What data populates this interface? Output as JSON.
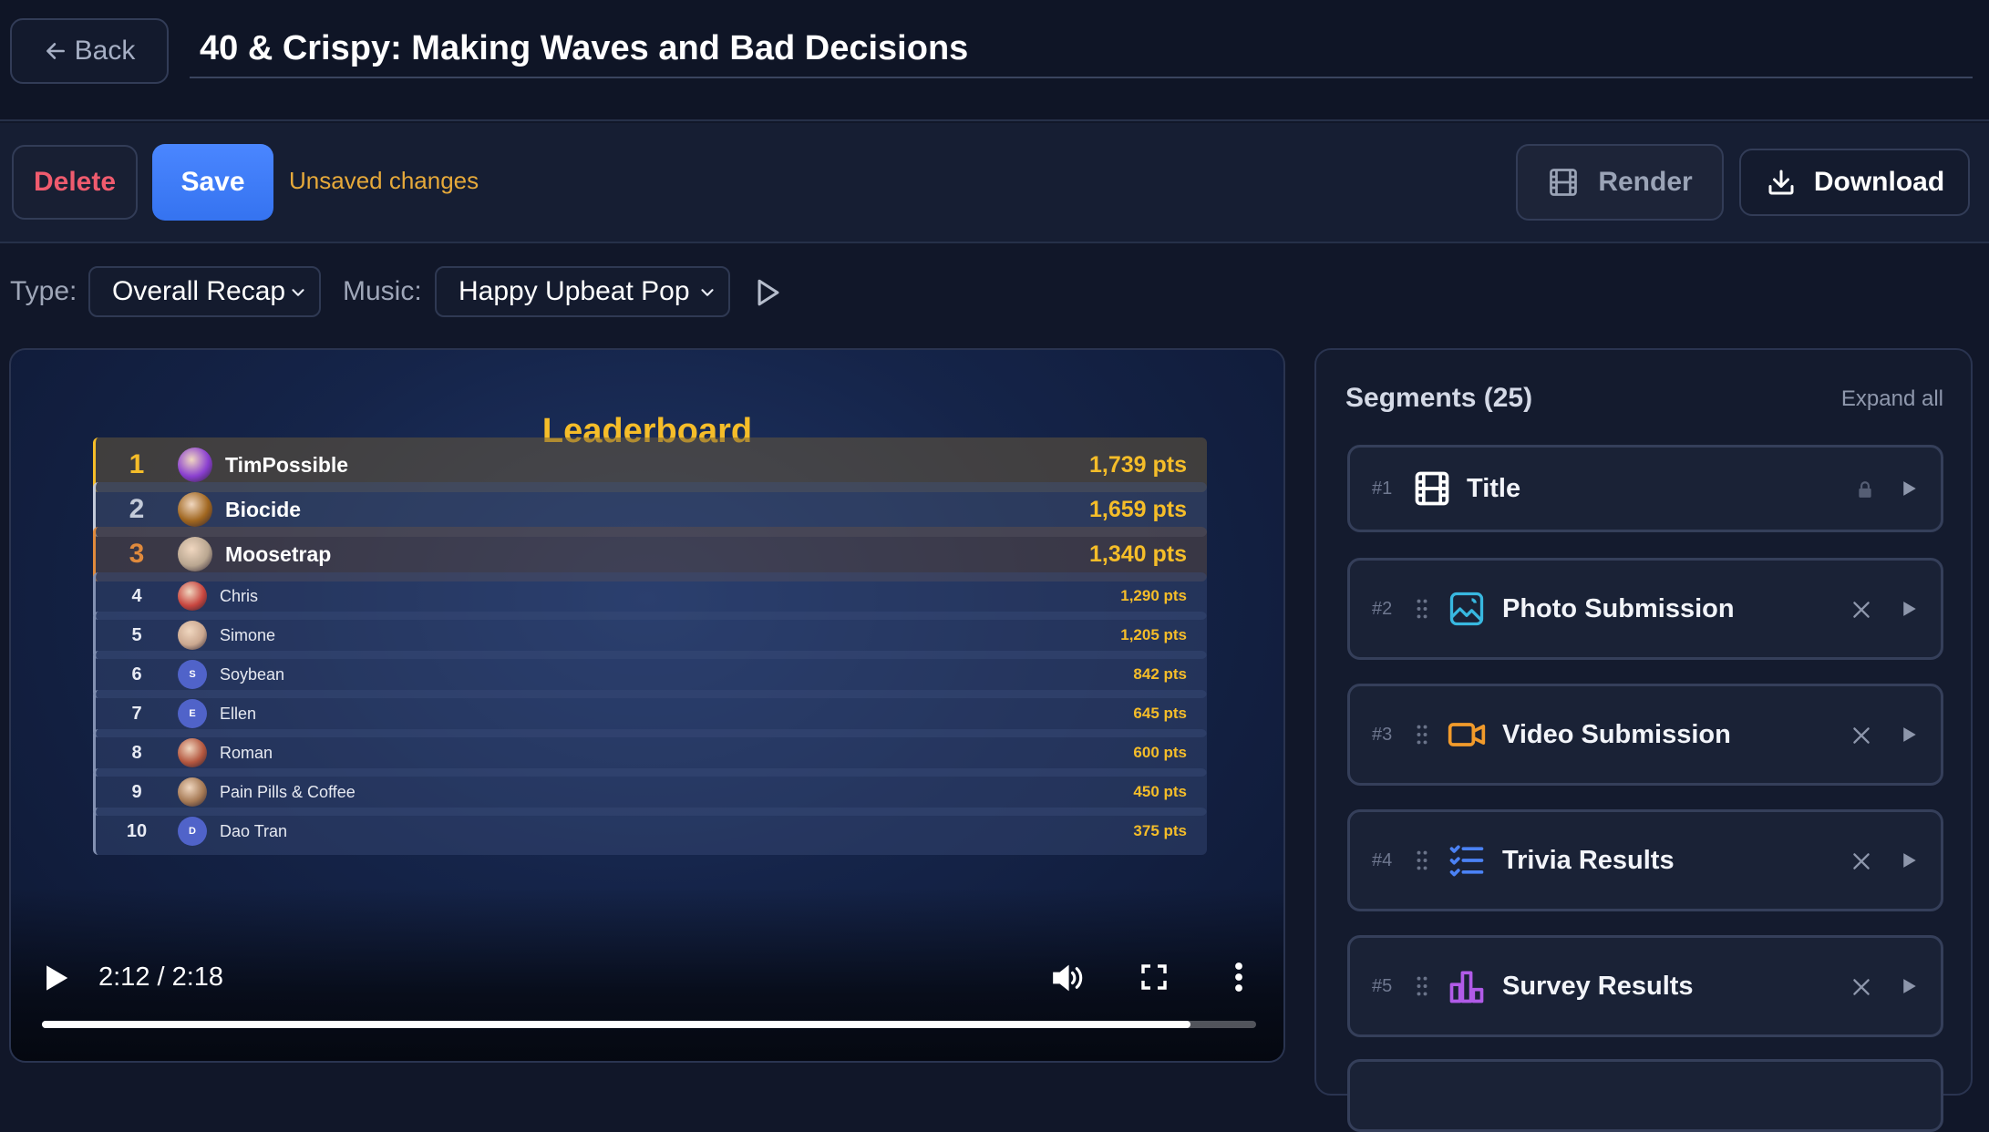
{
  "header": {
    "back_label": "Back",
    "title": "40 & Crispy: Making Waves and Bad Decisions"
  },
  "actions": {
    "delete_label": "Delete",
    "save_label": "Save",
    "status": "Unsaved changes",
    "render_label": "Render",
    "download_label": "Download"
  },
  "options": {
    "type_label": "Type:",
    "type_value": "Overall Recap",
    "music_label": "Music:",
    "music_value": "Happy Upbeat Pop"
  },
  "video": {
    "leaderboard_title": "Leaderboard",
    "time": "2:12 / 2:18",
    "progress": 0.946,
    "rows": [
      {
        "rank": "1",
        "name": "TimPossible",
        "pts": "1,739 pts",
        "rank_color": "#f5bd29",
        "border_color": "#f5bd29",
        "row_bg": "rgba(110,92,58,0.5)",
        "avatar_color": "#8a3fd0",
        "initial": ""
      },
      {
        "rank": "2",
        "name": "Biocide",
        "pts": "1,659 pts",
        "rank_color": "#c3cad8",
        "border_color": "#c3cad8",
        "row_bg": "rgba(64,78,112,0.55)",
        "avatar_color": "#a0661f",
        "initial": ""
      },
      {
        "rank": "3",
        "name": "Moosetrap",
        "pts": "1,340 pts",
        "rank_color": "#e08a3c",
        "border_color": "#e08a3c",
        "row_bg": "rgba(96,78,72,0.5)",
        "avatar_color": "#b9a690",
        "initial": ""
      },
      {
        "rank": "4",
        "name": "Chris",
        "pts": "1,290 pts",
        "rank_color": "#e8ebf4",
        "border_color": "#8391b2",
        "row_bg": "rgba(58,76,120,0.45)",
        "avatar_color": "#c8463f",
        "initial": ""
      },
      {
        "rank": "5",
        "name": "Simone",
        "pts": "1,205 pts",
        "rank_color": "#e8ebf4",
        "border_color": "#8391b2",
        "row_bg": "rgba(58,76,120,0.45)",
        "avatar_color": "#cba890",
        "initial": ""
      },
      {
        "rank": "6",
        "name": "Soybean",
        "pts": "842 pts",
        "rank_color": "#e8ebf4",
        "border_color": "#8391b2",
        "row_bg": "rgba(58,76,120,0.45)",
        "avatar_color": "#5063c9",
        "initial": "S"
      },
      {
        "rank": "7",
        "name": "Ellen",
        "pts": "645 pts",
        "rank_color": "#e8ebf4",
        "border_color": "#8391b2",
        "row_bg": "rgba(58,76,120,0.45)",
        "avatar_color": "#5063c9",
        "initial": "E"
      },
      {
        "rank": "8",
        "name": "Roman",
        "pts": "600 pts",
        "rank_color": "#e8ebf4",
        "border_color": "#8391b2",
        "row_bg": "rgba(58,76,120,0.45)",
        "avatar_color": "#b4573f",
        "initial": ""
      },
      {
        "rank": "9",
        "name": "Pain Pills & Coffee",
        "pts": "450 pts",
        "rank_color": "#e8ebf4",
        "border_color": "#8391b2",
        "row_bg": "rgba(58,76,120,0.45)",
        "avatar_color": "#a67a55",
        "initial": ""
      },
      {
        "rank": "10",
        "name": "Dao Tran",
        "pts": "375 pts",
        "rank_color": "#e8ebf4",
        "border_color": "#8391b2",
        "row_bg": "rgba(58,76,120,0.45)",
        "avatar_color": "#5063c9",
        "initial": "D"
      }
    ]
  },
  "segments": {
    "title": "Segments (25)",
    "expand_label": "Expand all",
    "items": [
      {
        "num": "#1",
        "label": "Title",
        "icon": "film-icon",
        "icon_color": "#ffffff",
        "locked": true
      },
      {
        "num": "#2",
        "label": "Photo Submission",
        "icon": "image-icon",
        "icon_color": "#38b8e0",
        "locked": false
      },
      {
        "num": "#3",
        "label": "Video Submission",
        "icon": "video-camera-icon",
        "icon_color": "#f29b2b",
        "locked": false
      },
      {
        "num": "#4",
        "label": "Trivia Results",
        "icon": "checklist-icon",
        "icon_color": "#4b82f5",
        "locked": false
      },
      {
        "num": "#5",
        "label": "Survey Results",
        "icon": "bar-chart-icon",
        "icon_color": "#b15be8",
        "locked": false
      }
    ]
  }
}
